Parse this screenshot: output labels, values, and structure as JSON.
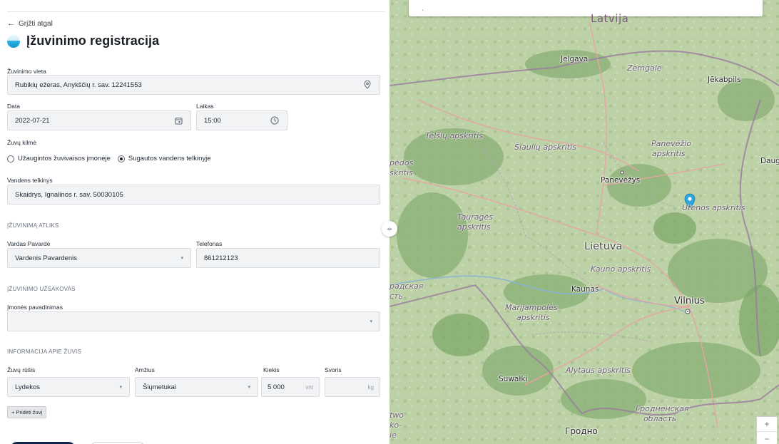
{
  "nav": {
    "back_label": "Grįžti atgal"
  },
  "page": {
    "title": "Įžuvinimo registracija"
  },
  "location": {
    "label": "Žuvinimo vieta",
    "value": "Rubikių ežeras, Anykščių r. sav. 12241553",
    "icon": "map-pin-icon"
  },
  "date": {
    "label": "Data",
    "value": "2022-07-21",
    "icon": "calendar-icon"
  },
  "time": {
    "label": "Laikas",
    "value": "15:00",
    "icon": "clock-icon"
  },
  "origin": {
    "label": "Žuvų kilmė",
    "options": [
      {
        "label": "Užaugintos žuvivaisos įmonėje",
        "selected": false
      },
      {
        "label": "Sugautos vandens telkinyje",
        "selected": true
      }
    ]
  },
  "water_body": {
    "label": "Vandens telkinys",
    "value": "Skaidrys, Ignalinos r. sav.  50030105"
  },
  "performer": {
    "section": "ĮŽUVINIMĄ ATLIKS",
    "name_label": "Vardas Pavardė",
    "name_value": "Vardenis Pavardenis",
    "phone_label": "Telefonas",
    "phone_value": "861212123"
  },
  "client": {
    "section": "ĮŽUVINIMO UŽSAKOVAS",
    "company_label": "Įmonės pavadinimas",
    "company_value": ""
  },
  "fish": {
    "section": "INFORMACIJA APIE ŽUVIS",
    "species_label": "Žuvų rūšis",
    "species_value": "Lydekos",
    "age_label": "Amžius",
    "age_value": "Šiųmetukai",
    "qty_label": "Kiekis",
    "qty_value": "5 000",
    "qty_unit": "vnt",
    "weight_label": "Svoris",
    "weight_value": "",
    "weight_unit": "kg",
    "add_label": "+ Pridėti žuvį"
  },
  "map": {
    "labels": {
      "latvija": "Latvija",
      "jelgava": "Jelgava",
      "zemgale": "Zemgale",
      "jekabpils": "Jēkabpils",
      "telsiu": "Telšių apskritis",
      "siauliu": "Šiaulių apskritis",
      "panevezio_1": "Panevėžio",
      "panevezio_2": "apskritis",
      "dau": "Daug",
      "pedos_1": "pėdos",
      "pedos_2": "skritis",
      "panevezys": "Panevėžys",
      "utenos": "Utenos apskritis",
      "taurages_1": "Tauragės",
      "taurages_2": "apskritis",
      "lietuva": "Lietuva",
      "kauno": "Kauno apskritis",
      "kaunas": "Kaunas",
      "vilnius": "Vilnius",
      "kaliningrad_1": "радская",
      "kaliningrad_2": "сть",
      "marijampoles_1": "Marijampolės",
      "marijampoles_2": "apskritis",
      "alytaus": "Alytaus apskritis",
      "suwalki": "Suwałki",
      "grodno_obl_1": "Гродненская",
      "grodno_obl_2": "область",
      "grodno": "Гродно",
      "two_1": "two",
      "two_2": "ko-",
      "two_3": "ie"
    },
    "zoom_in": "+",
    "zoom_out": "−",
    "colors": {
      "land": "#b9cfa2",
      "forest": "#8fb37a",
      "border": "#9a7aa0",
      "road": "#e8a4a4",
      "pin": "#2ea7e0"
    }
  },
  "splitter": {
    "icon": "drag-handle-icon",
    "glyph": "◂|▸"
  }
}
